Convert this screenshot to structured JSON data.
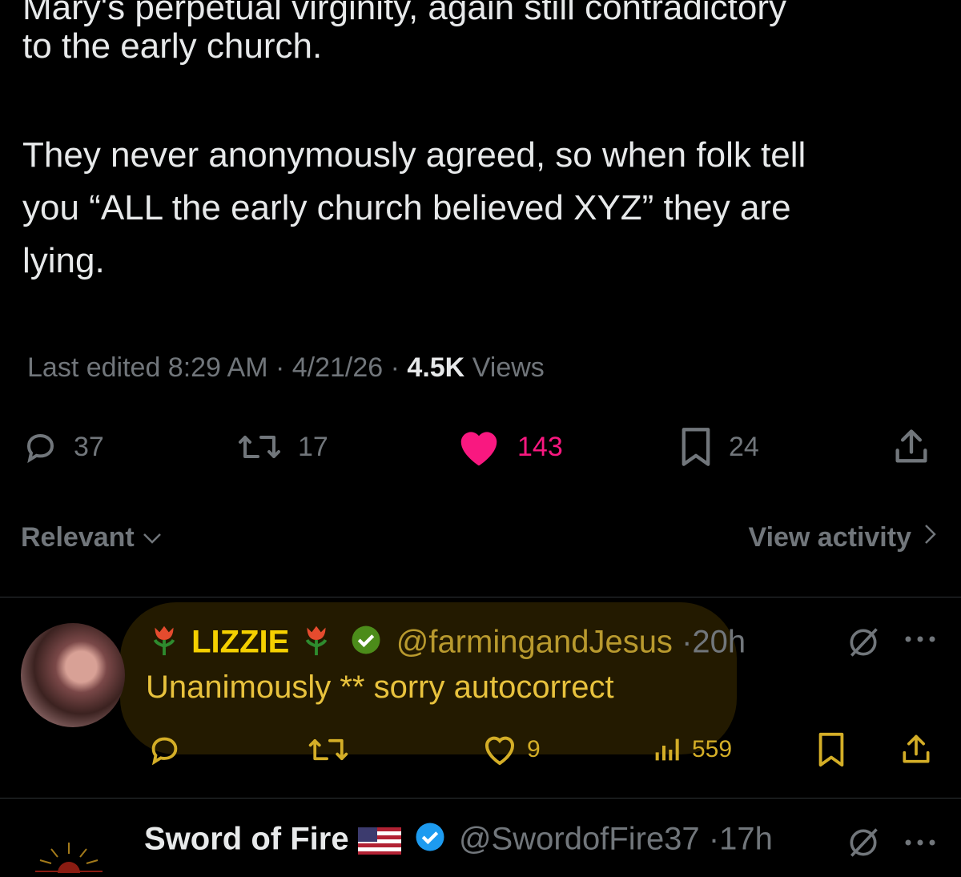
{
  "post": {
    "lines": [
      "Mary's perpetual virginity, again still contradictory",
      "to the early church.",
      "They never anonymously agreed, so when folk tell",
      "you “ALL the early church believed XYZ” they are",
      "lying."
    ],
    "meta_edited": "Last edited 8:29 AM · 4/21/26",
    "meta_sep": " · ",
    "views_count": "4.5K",
    "views_label": "Views",
    "actions": {
      "replies": "37",
      "reposts": "17",
      "likes": "143",
      "bookmarks": "24"
    },
    "like_color": "#f91880"
  },
  "filter": {
    "sort_label": "Relevant",
    "activity_label": "View activity"
  },
  "reply": {
    "name": "LIZZIE",
    "handle": "@farmingandJesus",
    "time_sep": "·",
    "time": "20h",
    "text": "Unanimously ** sorry autocorrect",
    "likes": "9",
    "views": "559",
    "highlight_color": "#e8c23d"
  },
  "next_reply": {
    "name": "Sword of Fire",
    "handle": "@SwordofFire37",
    "time_sep": "·",
    "time": "17h"
  }
}
